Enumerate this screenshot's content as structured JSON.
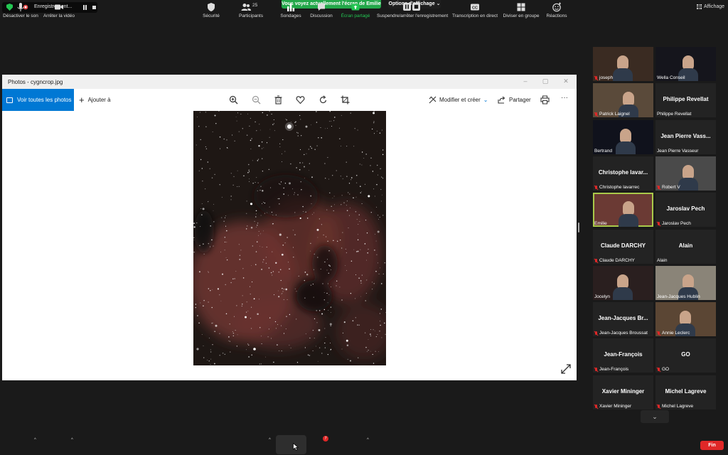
{
  "top": {
    "recording_label": "Enregistrement...",
    "share_banner": "Vous voyez actuellement l'écran de Emilie",
    "view_options": "Options d'affichage",
    "view_options_caret": "⌄",
    "layout_label": "Affichage"
  },
  "photos": {
    "title": "Photos - cygncrop.jpg",
    "window_controls": {
      "minimize": "–",
      "maximize": "▢",
      "close": "✕"
    },
    "see_all": "Voir toutes les photos",
    "add_to": "Ajouter à",
    "add_to_plus": "+",
    "edit_create": "Modifier et créer",
    "edit_create_caret": "⌄",
    "share": "Partager",
    "more": "···"
  },
  "participants": [
    {
      "name": "joseph",
      "muted": true,
      "video": true,
      "bg": "#3a2b22"
    },
    {
      "name": "Wella Conseil",
      "muted": false,
      "video": true,
      "bg": "#15151c"
    },
    {
      "name": "Patrick Laignel",
      "muted": true,
      "video": true,
      "bg": "#5a4a3a"
    },
    {
      "name": "Philippe Revellat",
      "big": "Philippe Revellat",
      "muted": false,
      "video": false,
      "bg": "#232323"
    },
    {
      "name": "Bertrand",
      "muted": false,
      "video": true,
      "bg": "#10121c"
    },
    {
      "name": "Jean Pierre Vasseur",
      "big": "Jean Pierre Vass...",
      "muted": false,
      "video": false,
      "bg": "#232323"
    },
    {
      "name": "Christophe lavarrec",
      "big": "Christophe lavar...",
      "muted": true,
      "video": false,
      "bg": "#232323"
    },
    {
      "name": "Robert V",
      "muted": true,
      "video": true,
      "bg": "#4a4a4a"
    },
    {
      "name": "Emilie",
      "muted": false,
      "video": true,
      "bg": "#6b3a34",
      "active": true
    },
    {
      "name": "Jaroslav Pech",
      "big": "Jaroslav Pech",
      "muted": true,
      "video": false,
      "bg": "#232323"
    },
    {
      "name": "Claude DARCHY",
      "big": "Claude DARCHY",
      "muted": true,
      "video": false,
      "bg": "#232323"
    },
    {
      "name": "Alain",
      "big": "Alain",
      "muted": false,
      "video": false,
      "bg": "#232323"
    },
    {
      "name": "Jocelyn",
      "muted": false,
      "video": true,
      "bg": "#2a1f1f"
    },
    {
      "name": "Jean-Jacques Hublin",
      "muted": false,
      "video": true,
      "bg": "#8a8478"
    },
    {
      "name": "Jean-Jacques Broussat",
      "big": "Jean-Jacques Br...",
      "muted": true,
      "video": false,
      "bg": "#232323"
    },
    {
      "name": "Annie Leclerc",
      "muted": true,
      "video": true,
      "bg": "#5b4634"
    },
    {
      "name": "Jean-François",
      "big": "Jean-François",
      "muted": true,
      "video": false,
      "bg": "#232323"
    },
    {
      "name": "GO",
      "big": "GO",
      "muted": true,
      "video": false,
      "bg": "#232323"
    },
    {
      "name": "Xavier Mininger",
      "big": "Xavier Mininger",
      "muted": true,
      "video": false,
      "bg": "#232323"
    },
    {
      "name": "Michel Lagreve",
      "big": "Michel Lagreve",
      "muted": true,
      "video": false,
      "bg": "#232323"
    }
  ],
  "gallery_more": "⌄",
  "bottom": {
    "mute": "Désactiver le son",
    "video": "Arrêter la vidéo",
    "security": "Sécurité",
    "participants": "Participants",
    "participants_count": "25",
    "polls": "Sondages",
    "chat": "Discussion",
    "chat_badge": "7",
    "share": "Écran partagé",
    "record": "Suspendre/arrêter l'enregistrement",
    "captions": "Transcription en direct",
    "breakout": "Diviser en groupe",
    "reactions": "Réactions",
    "end": "Fin",
    "caret": "^"
  }
}
